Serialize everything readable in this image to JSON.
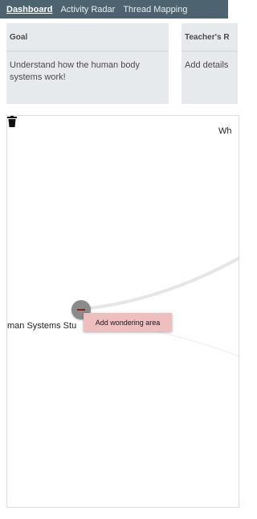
{
  "nav": {
    "tabs": [
      {
        "label": "Dashboard",
        "active": true
      },
      {
        "label": "Activity Radar",
        "active": false
      },
      {
        "label": "Thread Mapping",
        "active": false
      }
    ]
  },
  "cards": {
    "goal": {
      "title": "Goal",
      "body_line1": "Understand how the human body",
      "body_line2": "systems work!"
    },
    "teacher": {
      "title": "Teacher's R",
      "body": "Add details"
    }
  },
  "map": {
    "top_label": "Wh",
    "node_label": "man Systems Stu",
    "tooltip": "Add wondering area",
    "trash_icon": "trash-icon"
  },
  "colors": {
    "nav_bg": "#4d6470",
    "card_bg": "#e7eaed",
    "node": "#8b8b8b",
    "tooltip_bg": "#efbfc0"
  }
}
